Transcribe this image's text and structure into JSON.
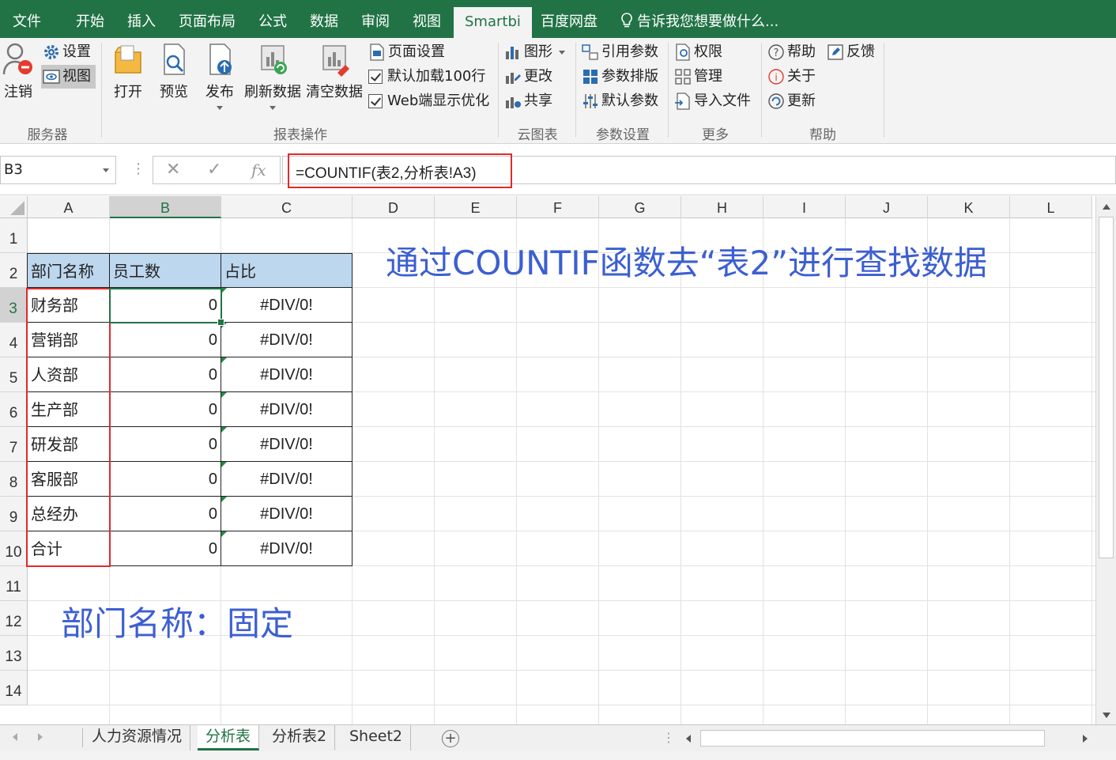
{
  "ribbon_tabs": [
    "文件",
    "开始",
    "插入",
    "页面布局",
    "公式",
    "数据",
    "审阅",
    "视图",
    "Smartbi",
    "百度网盘"
  ],
  "active_tab": "Smartbi",
  "tell_me": "告诉我您想要做什么...",
  "ribbon": {
    "server": {
      "label": "服务器",
      "logout": "注销",
      "settings": "设置",
      "view": "视图"
    },
    "report": {
      "label": "报表操作",
      "open": "打开",
      "preview": "预览",
      "publish": "发布",
      "refresh": "刷新数据",
      "clear": "清空数据",
      "page_setup": "页面设置",
      "default_load": "默认加载100行",
      "web_opt": "Web端显示优化"
    },
    "cloud": {
      "label": "云图表",
      "chart": "图形",
      "change": "更改",
      "share": "共享"
    },
    "params": {
      "label": "参数设置",
      "ref": "引用参数",
      "layout": "参数排版",
      "default": "默认参数"
    },
    "more": {
      "label": "更多",
      "perm": "权限",
      "manage": "管理",
      "import": "导入文件"
    },
    "help": {
      "label": "帮助",
      "help": "帮助",
      "feedback": "反馈",
      "about": "关于",
      "update": "更新"
    }
  },
  "name_box": "B3",
  "formula": "=COUNTIF(表2,分析表!A3)",
  "columns": [
    "A",
    "B",
    "C",
    "D",
    "E",
    "F",
    "G",
    "H",
    "I",
    "J",
    "K",
    "L"
  ],
  "rows": [
    "1",
    "2",
    "3",
    "4",
    "5",
    "6",
    "7",
    "8",
    "9",
    "10",
    "11",
    "12",
    "13",
    "14"
  ],
  "table": {
    "headers": [
      "部门名称",
      "员工数",
      "占比"
    ],
    "rows": [
      [
        "财务部",
        "0",
        "#DIV/0!"
      ],
      [
        "营销部",
        "0",
        "#DIV/0!"
      ],
      [
        "人资部",
        "0",
        "#DIV/0!"
      ],
      [
        "生产部",
        "0",
        "#DIV/0!"
      ],
      [
        "研发部",
        "0",
        "#DIV/0!"
      ],
      [
        "客服部",
        "0",
        "#DIV/0!"
      ],
      [
        "总经办",
        "0",
        "#DIV/0!"
      ],
      [
        "合计",
        "0",
        "#DIV/0!"
      ]
    ]
  },
  "annotations": {
    "top": "通过COUNTIF函数去“表2”进行查找数据",
    "bottom": "部门名称：固定"
  },
  "sheet_tabs": [
    "人力资源情况",
    "分析表",
    "分析表2",
    "Sheet2"
  ],
  "active_sheet": "分析表",
  "colors": {
    "excel_green": "#217346",
    "header_fill": "#bdd7ee",
    "annotation_blue": "#3c5fd1",
    "highlight_red": "#e02a2a"
  }
}
